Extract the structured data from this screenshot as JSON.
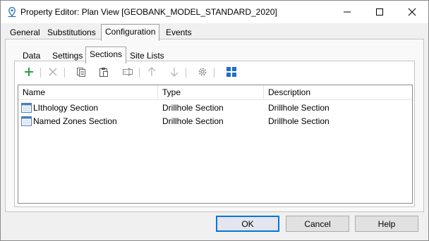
{
  "window": {
    "title": "Property Editor: Plan View [GEOBANK_MODEL_STANDARD_2020]",
    "icon": "location-pin-icon"
  },
  "main_tabs": [
    {
      "label": "General",
      "active": false
    },
    {
      "label": "Substitutions",
      "active": false
    },
    {
      "label": "Configuration",
      "active": true
    },
    {
      "label": "Events",
      "active": false
    }
  ],
  "sub_tabs": [
    {
      "label": "Data",
      "active": false
    },
    {
      "label": "Settings",
      "active": false
    },
    {
      "label": "Sections",
      "active": true
    },
    {
      "label": "Site Lists",
      "active": false
    }
  ],
  "toolbar": {
    "icons": [
      "add-icon",
      "delete-icon",
      "copy-icon",
      "paste-icon",
      "rename-icon",
      "move-up-icon",
      "move-down-icon",
      "settings-icon",
      "grid-view-icon"
    ]
  },
  "grid": {
    "columns": [
      "Name",
      "Type",
      "Description"
    ],
    "rows": [
      {
        "name": "LIthology Section",
        "type": "Drillhole Section",
        "description": "Drillhole Section"
      },
      {
        "name": "Named Zones Section",
        "type": "Drillhole Section",
        "description": "Drillhole Section"
      }
    ]
  },
  "buttons": {
    "ok": "OK",
    "cancel": "Cancel",
    "help": "Help"
  },
  "colors": {
    "accent": "#0078d7",
    "add_green": "#2e9e3e"
  }
}
